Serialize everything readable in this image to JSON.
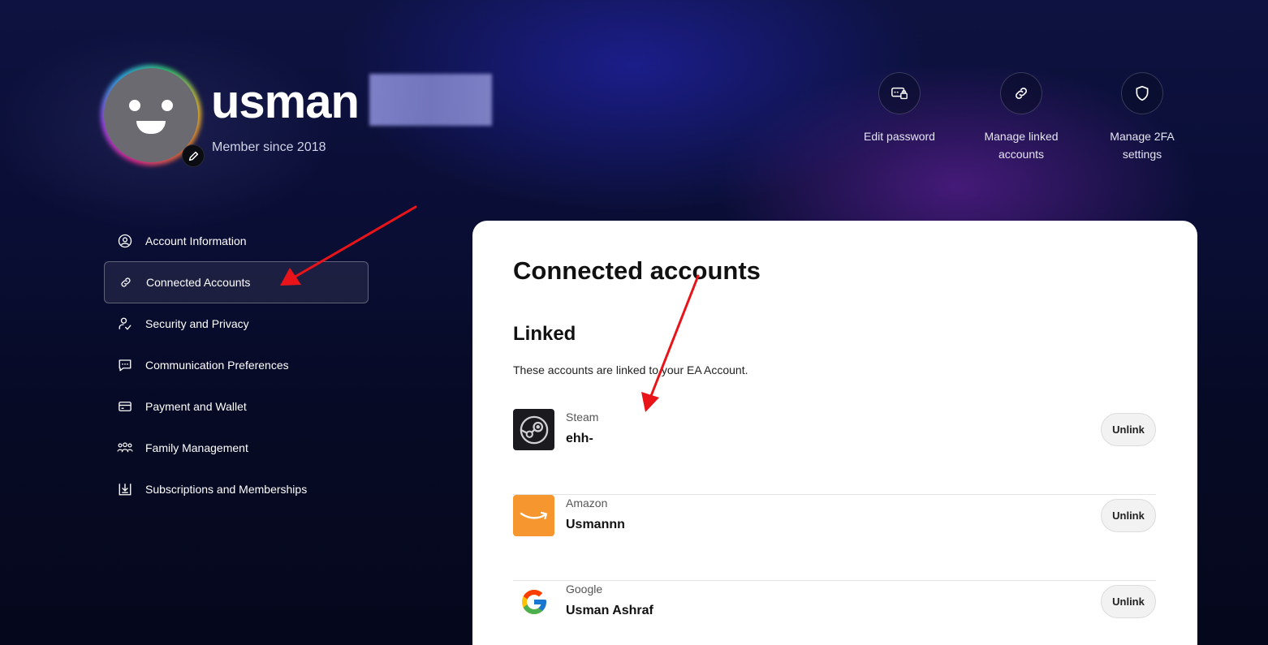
{
  "profile": {
    "username": "usman",
    "member_since": "Member since 2018"
  },
  "quick_actions": [
    {
      "label": "Edit password",
      "icon": "password-lock-icon"
    },
    {
      "label": "Manage linked accounts",
      "icon": "link-icon"
    },
    {
      "label": "Manage 2FA settings",
      "icon": "shield-icon"
    }
  ],
  "sidebar": {
    "items": [
      {
        "label": "Account Information",
        "icon": "user-circle-icon",
        "active": false
      },
      {
        "label": "Connected Accounts",
        "icon": "link-icon",
        "active": true
      },
      {
        "label": "Security and Privacy",
        "icon": "user-check-icon",
        "active": false
      },
      {
        "label": "Communication Preferences",
        "icon": "chat-icon",
        "active": false
      },
      {
        "label": "Payment and Wallet",
        "icon": "wallet-icon",
        "active": false
      },
      {
        "label": "Family Management",
        "icon": "family-icon",
        "active": false
      },
      {
        "label": "Subscriptions and Memberships",
        "icon": "download-box-icon",
        "active": false
      }
    ]
  },
  "main": {
    "title": "Connected accounts",
    "linked_section": {
      "title": "Linked",
      "description": "These accounts are linked to your EA Account."
    },
    "accounts": [
      {
        "provider": "Steam",
        "name": "ehh-",
        "action": "Unlink",
        "icon": "steam-logo-icon",
        "color": "#1b1b1f"
      },
      {
        "provider": "Amazon",
        "name": "Usmannn",
        "action": "Unlink",
        "icon": "amazon-logo-icon",
        "color": "#f5962e"
      },
      {
        "provider": "Google",
        "name": "Usman Ashraf",
        "action": "Unlink",
        "icon": "google-logo-icon",
        "color": "#ffffff"
      }
    ]
  },
  "colors": {
    "annotation_arrow": "#e8141a",
    "background_dark": "#060a24",
    "card": "#ffffff"
  }
}
